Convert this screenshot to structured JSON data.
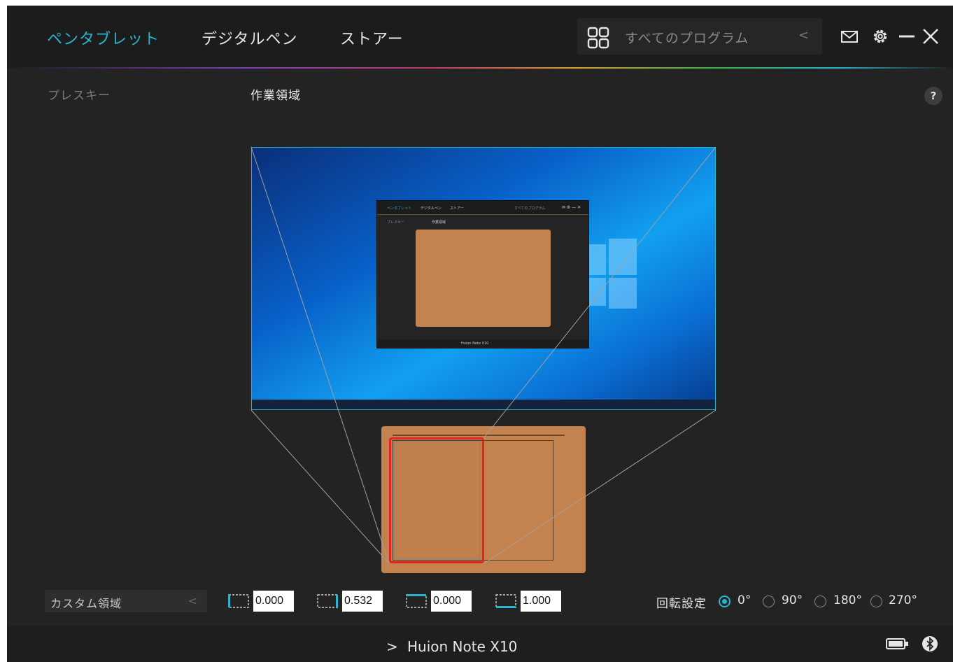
{
  "header": {
    "tabs": [
      {
        "label": "ペンタブレット",
        "active": true
      },
      {
        "label": "デジタルペン",
        "active": false
      },
      {
        "label": "ストアー",
        "active": false
      }
    ],
    "program_selector": {
      "label": "すべてのプログラム",
      "icon": "grid-icon"
    },
    "icons": [
      "mail-icon",
      "gear-icon",
      "minimize-icon",
      "close-icon"
    ]
  },
  "subtabs": [
    {
      "label": "プレスキー",
      "active": false
    },
    {
      "label": "作業領域",
      "active": true
    }
  ],
  "help": {
    "label": "?"
  },
  "mini_window": {
    "tabs": [
      "ペンタブレット",
      "デジタルペン",
      "ストアー"
    ],
    "program": "すべてのプログラム",
    "subtabs": [
      "プレスキー",
      "作業領域"
    ],
    "device": "Huion Note X10"
  },
  "controls": {
    "area_mode": "カスタム領域",
    "coords": [
      {
        "icon": "left-edge-icon",
        "value": "0.000"
      },
      {
        "icon": "right-edge-icon",
        "value": "0.532"
      },
      {
        "icon": "top-edge-icon",
        "value": "0.000"
      },
      {
        "icon": "bottom-edge-icon",
        "value": "1.000"
      }
    ],
    "rotation": {
      "label": "回転設定",
      "options": [
        {
          "label": "0°",
          "checked": true
        },
        {
          "label": "90°",
          "checked": false
        },
        {
          "label": "180°",
          "checked": false
        },
        {
          "label": "270°",
          "checked": false
        }
      ]
    }
  },
  "footer": {
    "device": "Huion Note X10",
    "icons": [
      "battery-icon",
      "bluetooth-icon"
    ]
  },
  "colors": {
    "accent": "#2bb3cf",
    "work_area": "#e3231e",
    "tablet": "#c4824f",
    "background": "#232323"
  }
}
